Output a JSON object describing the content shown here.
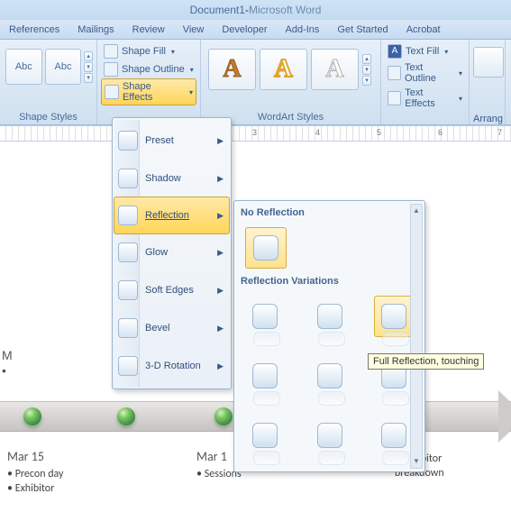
{
  "title": {
    "doc": "Document1",
    "sep": " - ",
    "app": "Microsoft Word"
  },
  "tabs": [
    "References",
    "Mailings",
    "Review",
    "View",
    "Developer",
    "Add-Ins",
    "Get Started",
    "Acrobat"
  ],
  "ribbon": {
    "shape_styles": {
      "label": "Shape Styles",
      "samples": [
        "Abc",
        "Abc"
      ]
    },
    "shape_cmds": {
      "fill": "Shape Fill",
      "outline": "Shape Outline",
      "effects": "Shape Effects"
    },
    "wa_styles": {
      "label": "WordArt Styles"
    },
    "wa_cmds": {
      "fill": "Text Fill",
      "outline": "Text Outline",
      "effects": "Text Effects"
    },
    "arrange": {
      "label": "Arrang"
    }
  },
  "effects_menu": {
    "items": [
      {
        "label": "Preset"
      },
      {
        "label": "Shadow"
      },
      {
        "label": "Reflection",
        "selected": true
      },
      {
        "label": "Glow"
      },
      {
        "label": "Soft Edges"
      },
      {
        "label": "Bevel"
      },
      {
        "label": "3-D Rotation"
      }
    ]
  },
  "reflection_gallery": {
    "section1": "No Reflection",
    "section2": "Reflection Variations",
    "tooltip": "Full Reflection, touching"
  },
  "doc_content": {
    "partial_m": "M",
    "partial_bullet": "•",
    "col1": {
      "heading": "Mar 15",
      "items": [
        "Precon day",
        "Exhibitor"
      ]
    },
    "col2": {
      "heading": "Mar 1",
      "items": [
        "Sessions"
      ]
    },
    "col3": {
      "heading": "",
      "items": [
        "Exhibitor breakdown"
      ]
    }
  }
}
